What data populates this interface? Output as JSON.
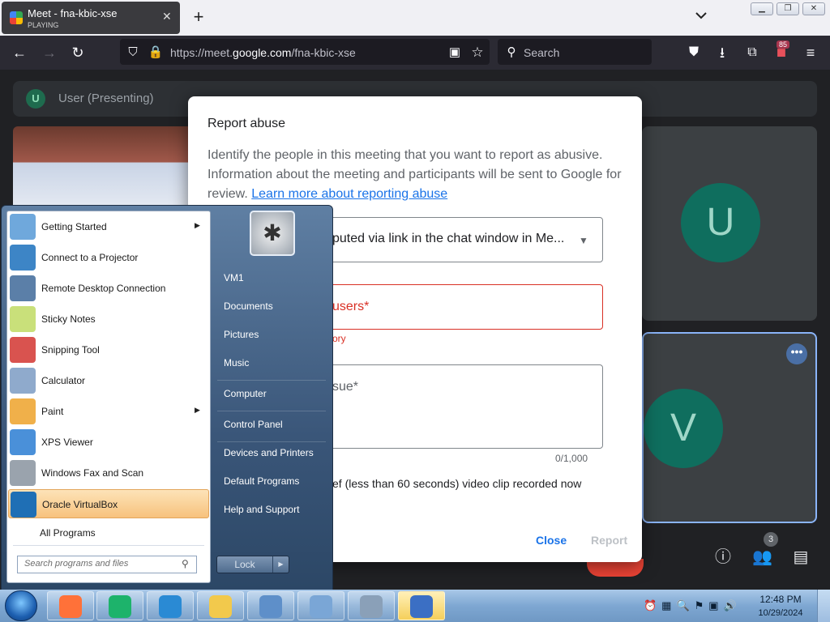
{
  "browser": {
    "tab_title": "Meet - fna-kbic-xse",
    "tab_status": "PLAYING",
    "tab_close": "✕",
    "new_tab": "+",
    "url_prefix": "https://meet.",
    "url_domain": "google.com",
    "url_path": "/fna-kbic-xse",
    "search_placeholder": "Search",
    "extension_badge": "85"
  },
  "meet": {
    "presenter_initial": "U",
    "presenter_label": "User (Presenting)",
    "tile_u_initial": "U",
    "tile_v_initial": "V",
    "people_count": "3",
    "more_glyph": "•••"
  },
  "dialog": {
    "title": "Report abuse",
    "description": "Identify the people in this meeting that you want to report as abusive. Information about the meeting and participants will be sent to Google for review.",
    "link": "Learn more about reporting abuse",
    "dropdown_value": "puted via link in the chat window in Me...",
    "abusers_label": "users*",
    "abusers_error": "ory",
    "issue_label": "sue*",
    "counter": "0/1,000",
    "clip_text": "ef (less than 60 seconds) video clip recorded now",
    "close": "Close",
    "report": "Report"
  },
  "start_menu": {
    "programs": [
      {
        "label": "Getting Started",
        "submenu": true,
        "icon": "getting-started-icon",
        "color": "#6fa8dc"
      },
      {
        "label": "Connect to a Projector",
        "submenu": false,
        "icon": "projector-icon",
        "color": "#3d85c6"
      },
      {
        "label": "Remote Desktop Connection",
        "submenu": false,
        "icon": "remote-desktop-icon",
        "color": "#5b7fa8"
      },
      {
        "label": "Sticky Notes",
        "submenu": false,
        "icon": "sticky-notes-icon",
        "color": "#c9e07a"
      },
      {
        "label": "Snipping Tool",
        "submenu": false,
        "icon": "scissors-icon",
        "color": "#d9534f"
      },
      {
        "label": "Calculator",
        "submenu": false,
        "icon": "calculator-icon",
        "color": "#8faacc"
      },
      {
        "label": "Paint",
        "submenu": true,
        "icon": "paint-icon",
        "color": "#f0b04a"
      },
      {
        "label": "XPS Viewer",
        "submenu": false,
        "icon": "xps-viewer-icon",
        "color": "#4a90d9"
      },
      {
        "label": "Windows Fax and Scan",
        "submenu": false,
        "icon": "fax-icon",
        "color": "#9aa3ad"
      },
      {
        "label": "Oracle VirtualBox",
        "submenu": false,
        "icon": "virtualbox-icon",
        "color": "#1f6fb5"
      }
    ],
    "all_programs": "All Programs",
    "search_placeholder": "Search programs and files",
    "right_items": [
      "VM1",
      "Documents",
      "Pictures",
      "Music",
      "Computer",
      "Control Panel",
      "Devices and Printers",
      "Default Programs",
      "Help and Support"
    ],
    "lock_label": "Lock",
    "lock_arrow": "▶"
  },
  "taskbar": {
    "apps": [
      {
        "name": "firefox",
        "color": "#ff7139"
      },
      {
        "name": "app-green",
        "color": "#1db36b"
      },
      {
        "name": "internet-explorer",
        "color": "#2a8ad4"
      },
      {
        "name": "file-explorer",
        "color": "#f2c94c"
      },
      {
        "name": "document-app",
        "color": "#5e8fc9"
      },
      {
        "name": "network-app",
        "color": "#7aa6d6"
      },
      {
        "name": "computer-app",
        "color": "#8aa0b8"
      },
      {
        "name": "security-shield",
        "color": "#3b6fc4"
      }
    ],
    "time": "12:48 PM",
    "date": "10/29/2024"
  }
}
